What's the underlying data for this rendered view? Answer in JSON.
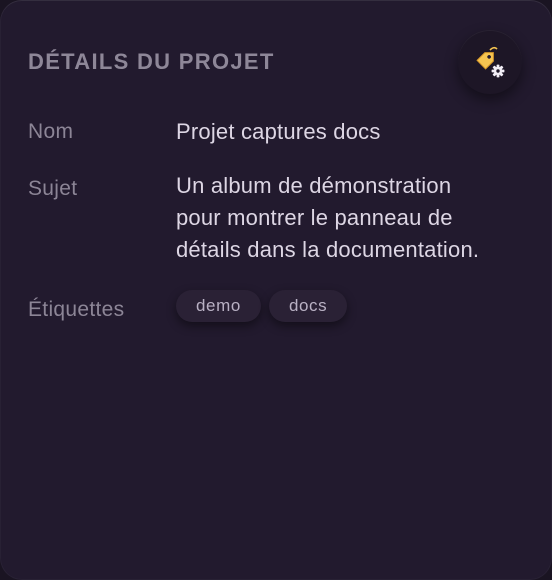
{
  "panel": {
    "title": "DÉTAILS DU PROJET",
    "action_icon": "tag-gear-icon"
  },
  "details": {
    "name": {
      "label": "Nom",
      "value": "Projet captures docs"
    },
    "subject": {
      "label": "Sujet",
      "value_lines": [
        "Un album de démonstration",
        "pour montrer le panneau de",
        "détails dans la documentation."
      ]
    },
    "tags": {
      "label": "Étiquettes",
      "items": [
        "demo",
        "docs"
      ]
    }
  },
  "colors": {
    "panel_bg": "#221a2e",
    "label": "#8c8596",
    "value": "#ddd6e4",
    "accent": "#f5c451"
  }
}
